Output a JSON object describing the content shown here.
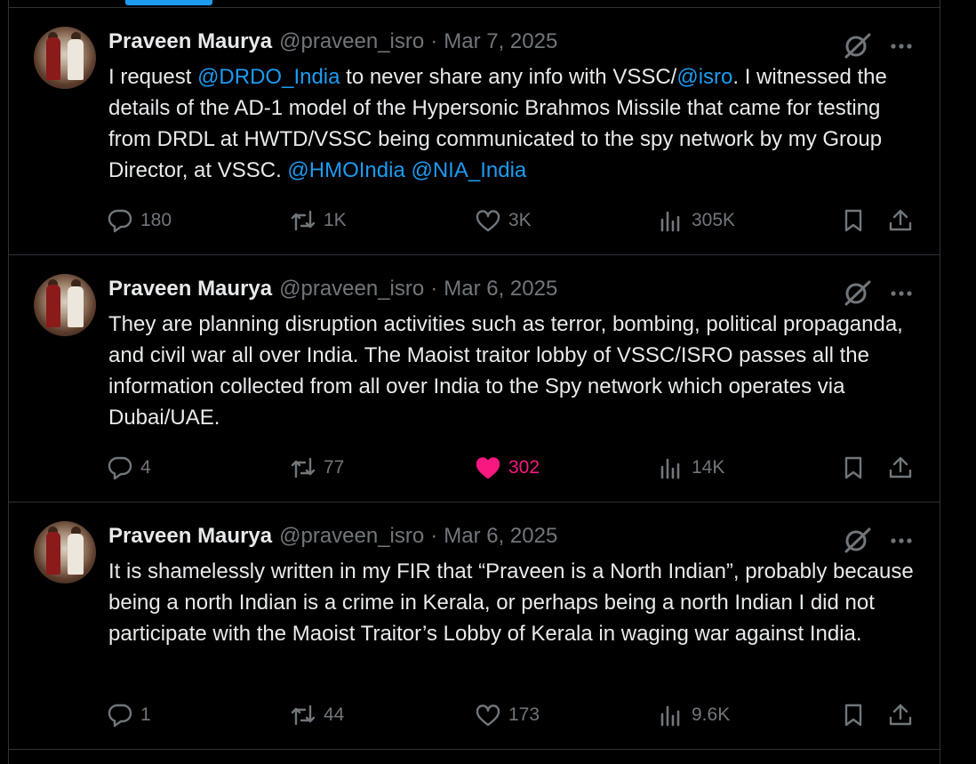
{
  "tweets": [
    {
      "name": "Praveen Maurya",
      "handle": "@praveen_isro",
      "sep": "·",
      "date": "Mar 7, 2025",
      "text": {
        "p1": "I request ",
        "m1": "@DRDO_India",
        "p2": " to never share any info with VSSC/",
        "m2": "@isro",
        "p3": ". I witnessed the details of the AD-1 model of the Hypersonic Brahmos Missile that came for testing from DRDL at HWTD/VSSC being communicated to the spy network by my Group Director, at VSSC. ",
        "m3": "@HMOIndia",
        "p4": " ",
        "m4": "@NIA_India"
      },
      "replies": "180",
      "reposts": "1K",
      "likes": "3K",
      "views": "305K",
      "liked": false
    },
    {
      "name": "Praveen Maurya",
      "handle": "@praveen_isro",
      "sep": "·",
      "date": "Mar 6, 2025",
      "text": "They are planning disruption activities such as terror, bombing, political propaganda, and civil war all over India. The Maoist traitor lobby of VSSC/ISRO passes all the information collected from all over India to the Spy network which operates via Dubai/UAE.",
      "replies": "4",
      "reposts": "77",
      "likes": "302",
      "views": "14K",
      "liked": true
    },
    {
      "name": "Praveen Maurya",
      "handle": "@praveen_isro",
      "sep": "·",
      "date": "Mar 6, 2025",
      "text": "It is shamelessly written in my FIR that “Praveen is a North Indian”, probably because being a north Indian is a crime in Kerala, or perhaps being a north Indian I did not participate with the Maoist Traitor’s Lobby of Kerala in waging war against India.",
      "replies": "1",
      "reposts": "44",
      "likes": "173",
      "views": "9.6K",
      "liked": false
    }
  ],
  "colors": {
    "background": "#000000",
    "text": "#e7e9ea",
    "muted": "#71767b",
    "accent": "#1d9bf0",
    "like_active": "#f91880",
    "border": "#2f3336"
  },
  "icons": [
    "grok-icon",
    "more-icon",
    "reply-icon",
    "repost-icon",
    "like-icon",
    "views-icon",
    "bookmark-icon",
    "share-icon"
  ]
}
